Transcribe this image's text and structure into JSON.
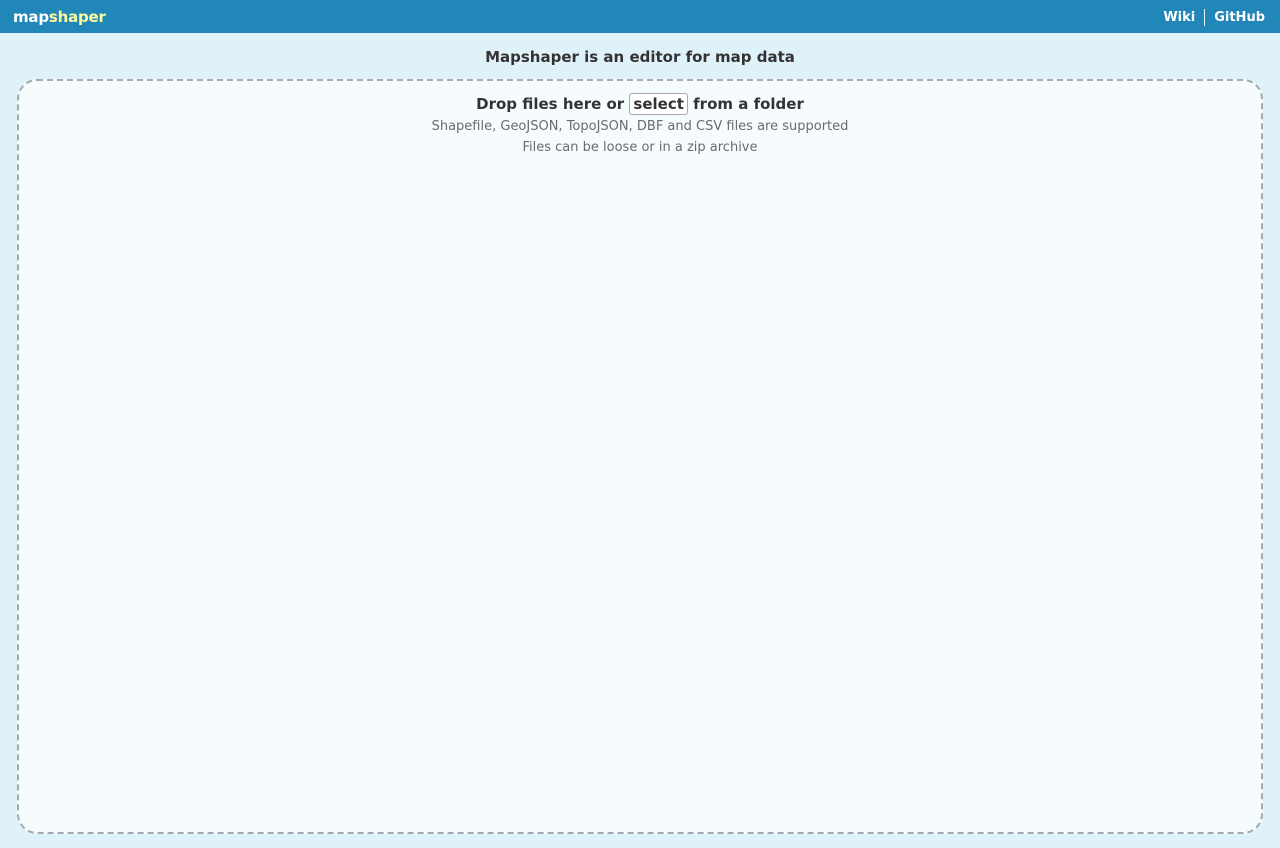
{
  "header": {
    "logo_part1": "map",
    "logo_part2": "shaper",
    "nav": {
      "wiki": "Wiki",
      "github": "GitHub"
    }
  },
  "main": {
    "headline": "Mapshaper is an editor for map data",
    "dropzone": {
      "prefix": "Drop files here or",
      "select_label": "select",
      "suffix": "from a folder",
      "supported_formats": "Shapefile, GeoJSON, TopoJSON, DBF and CSV files are supported",
      "archive_note": "Files can be loose or in a zip archive"
    }
  },
  "colors": {
    "header_bg": "#2186b8",
    "page_bg": "#dff1f9",
    "logo_accent": "#fdfb9c",
    "dropzone_bg": "#f6fbfe"
  }
}
